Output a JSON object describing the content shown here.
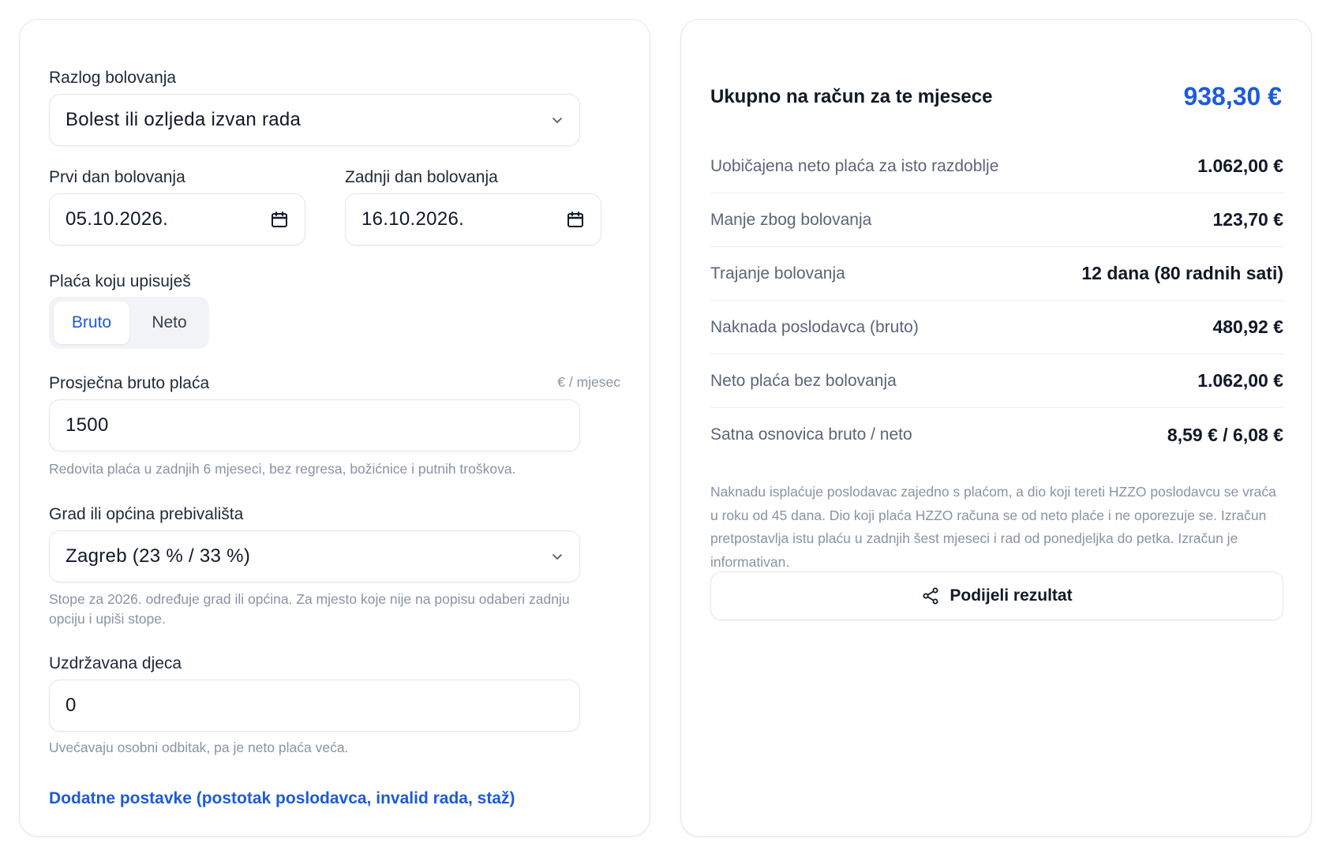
{
  "form": {
    "reason_label": "Razlog bolovanja",
    "reason_value": "Bolest ili ozljeda izvan rada",
    "first_day_label": "Prvi dan bolovanja",
    "first_day_value": "05.10.2026.",
    "last_day_label": "Zadnji dan bolovanja",
    "last_day_value": "16.10.2026.",
    "salary_type_label": "Plaća koju upisuješ",
    "salary_type_options": [
      "Bruto",
      "Neto"
    ],
    "salary_type_selected": "Bruto",
    "avg_salary_label": "Prosječna bruto plaća",
    "avg_salary_unit": "€ / mjesec",
    "avg_salary_value": "1500",
    "avg_salary_hint": "Redovita plaća u zadnjih 6 mjeseci, bez regresa, božićnice i putnih troškova.",
    "city_label": "Grad ili općina prebivališta",
    "city_value": "Zagreb (23 % / 33 %)",
    "city_hint": "Stope za 2026. određuje grad ili općina. Za mjesto koje nije na popisu odaberi zadnju opciju i upiši stope.",
    "children_label": "Uzdržavana djeca",
    "children_value": "0",
    "children_hint": "Uvećavaju osobni odbitak, pa je neto plaća veća.",
    "advanced_link": "Dodatne postavke (postotak poslodavca, invalid rada, staž)"
  },
  "result": {
    "total_label": "Ukupno na račun za te mjesece",
    "total_value": "938,30 €",
    "rows": [
      {
        "label": "Uobičajena neto plaća za isto razdoblje",
        "value": "1.062,00 €"
      },
      {
        "label": "Manje zbog bolovanja",
        "value": "123,70 €"
      },
      {
        "label": "Trajanje bolovanja",
        "value": "12 dana (80 radnih sati)"
      },
      {
        "label": "Naknada poslodavca (bruto)",
        "value": "480,92 €"
      },
      {
        "label": "Neto plaća bez bolovanja",
        "value": "1.062,00 €"
      },
      {
        "label": "Satna osnovica bruto / neto",
        "value": "8,59 € / 6,08 €"
      }
    ],
    "note": "Naknadu isplaćuje poslodavac zajedno s plaćom, a dio koji tereti HZZO poslodavcu se vraća u roku od 45 dana. Dio koji plaća HZZO računa se od neto plaće i ne oporezuje se. Izračun pretpostavlja istu plaću u zadnjih šest mjeseci i rad od ponedjeljka do petka. Izračun je informativan.",
    "share_label": "Podijeli rezultat"
  },
  "colors": {
    "accent": "#1d5bd8",
    "border": "#e3e6eb",
    "muted": "#8a93a3"
  },
  "icons": [
    "chevron-down-icon",
    "calendar-icon",
    "share-icon"
  ]
}
